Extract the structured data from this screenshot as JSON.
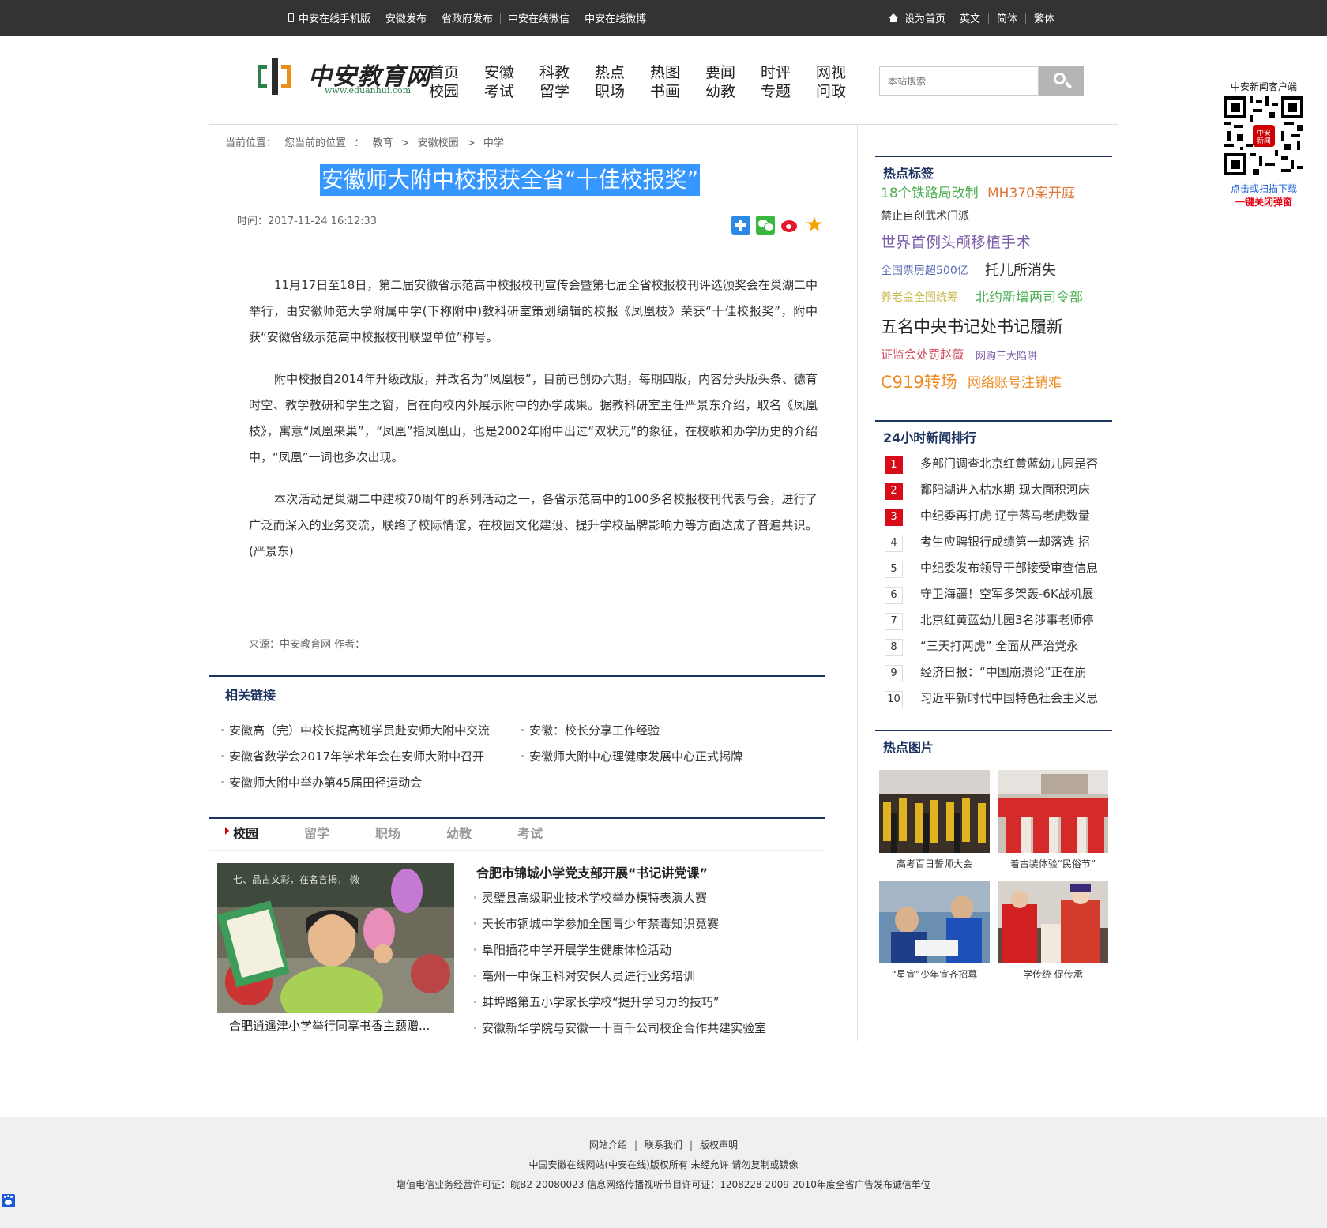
{
  "topbar": {
    "left_links": [
      "中安在线手机版",
      "安徽发布",
      "省政府发布",
      "中安在线微信",
      "中安在线微博"
    ],
    "right_links": [
      "设为首页",
      "英文",
      "简体",
      "繁体"
    ]
  },
  "logo": {
    "name": "中安教育网",
    "url": "www.eduanhui.com"
  },
  "nav": [
    [
      "首页",
      "校园"
    ],
    [
      "安徽",
      "考试"
    ],
    [
      "科教",
      "留学"
    ],
    [
      "热点",
      "职场"
    ],
    [
      "热图",
      "书画"
    ],
    [
      "要闻",
      "幼教"
    ],
    [
      "时评",
      "专题"
    ],
    [
      "网视",
      "问政"
    ]
  ],
  "search": {
    "placeholder": "本站搜索"
  },
  "qr": {
    "title": "中安新闻客户端",
    "line1": "点击或扫描下载",
    "line2": "一键关闭弹窗"
  },
  "breadcrumb": {
    "label": "当前位置：",
    "items": [
      "您当前的位置",
      "：",
      "教育",
      "&gt;",
      "安徽校园",
      "&gt;",
      "中学"
    ]
  },
  "article": {
    "title": "安徽师大附中校报获全省“十佳校报奖”",
    "time": "时间：2017-11-24 16:12:33",
    "paragraphs": [
      "11月17日至18日，第二届安徽省示范高中校报校刊宣传会暨第七届全省校报校刊评选颁奖会在巢湖二中举行，由安徽师范大学附属中学(下称附中)教科研室策划编辑的校报《凤凰枝》荣获“十佳校报奖”，附中获“安徽省级示范高中校报校刊联盟单位”称号。",
      "附中校报自2014年升级改版，并改名为“凤凰枝”，目前已创办六期，每期四版，内容分头版头条、德育时空、教学教研和学生之窗，旨在向校内外展示附中的办学成果。据教科研室主任严景东介绍，取名《凤凰枝》，寓意“凤凰来巢”，“凤凰”指凤凰山，也是2002年附中出过“双状元”的象征，在校歌和办学历史的介绍中，“凤凰”一词也多次出现。",
      "本次活动是巢湖二中建校70周年的系列活动之一，各省示范高中的100多名校报校刊代表与会，进行了广泛而深入的业务交流，联络了校际情谊，在校园文化建设、提升学校品牌影响力等方面达成了普遍共识。(严景东)"
    ],
    "source": "来源：中安教育网  作者："
  },
  "related": {
    "title": "相关链接",
    "links": [
      "安徽高（完）中校长提高班学员赴安师大附中交流",
      "安徽：校长分享工作经验",
      "安徽省数学会2017年学术年会在安师大附中召开",
      "安徽师大附中心理健康发展中心正式揭牌",
      "安徽师大附中举办第45届田径运动会"
    ]
  },
  "campus": {
    "tabs": [
      "校园",
      "留学",
      "职场",
      "幼教",
      "考试"
    ],
    "image_caption": "合肥逍遥津小学举行同享书香主题赠...",
    "headline": "合肥市锦城小学党支部开展“书记讲党课”",
    "list": [
      "灵璧县高级职业技术学校举办模特表演大赛",
      "天长市铜城中学参加全国青少年禁毒知识竞赛",
      "阜阳插花中学开展学生健康体检活动",
      "亳州一中保卫科对安保人员进行业务培训",
      "蚌埠路第五小学家长学校“提升学习力的技巧”",
      "安徽新华学院与安徽一十百千公司校企合作共建实验室"
    ]
  },
  "hot_tags": {
    "title": "热点标签",
    "tags": [
      {
        "text": "18个铁路局改制",
        "color": "#4caf50",
        "size": 17
      },
      {
        "text": "MH370案开庭",
        "color": "#e0763a",
        "size": 17
      },
      {
        "text": "禁止自创武术门派",
        "color": "#333333",
        "size": 14
      },
      {
        "text": "世界首例头颅移植手术",
        "color": "#7c5ca8",
        "size": 19
      },
      {
        "text": "全国票房超500亿",
        "color": "#5b6bb5",
        "size": 14
      },
      {
        "text": "托儿所消失",
        "color": "#333333",
        "size": 18
      },
      {
        "text": "养老金全国统筹",
        "color": "#c8b84a",
        "size": 14
      },
      {
        "text": "北约新增两司令部",
        "color": "#4caf50",
        "size": 17
      },
      {
        "text": "五名中央书记处书记履新",
        "color": "#222222",
        "size": 21
      },
      {
        "text": "证监会处罚赵薇",
        "color": "#d0495a",
        "size": 15
      },
      {
        "text": "网购三大陷阱",
        "color": "#7c5ca8",
        "size": 13
      },
      {
        "text": "C919转场",
        "color": "#f08a22",
        "size": 21
      },
      {
        "text": "网络账号注销难",
        "color": "#f08a22",
        "size": 17
      }
    ]
  },
  "ranking": {
    "title": "24小时新闻排行",
    "items": [
      "多部门调查北京红黄蓝幼儿园是否",
      "鄱阳湖进入枯水期 现大面积河床",
      "中纪委再打虎 辽宁落马老虎数量",
      "考生应聘银行成绩第一却落选 招",
      "中纪委发布领导干部接受审查信息",
      "守卫海疆！空军多架轰-6K战机展",
      "北京红黄蓝幼儿园3名涉事老师停",
      "“三天打两虎” 全面从严治党永",
      "经济日报：“中国崩溃论”正在崩",
      "习近平新时代中国特色社会主义思"
    ],
    "numbers": [
      "1",
      "2",
      "3",
      "4",
      "5",
      "6",
      "7",
      "8",
      "9",
      "10"
    ]
  },
  "hot_pics": {
    "title": "热点图片",
    "captions": [
      "高考百日誓师大会",
      "着古装体验“民俗节”",
      "“星宣”少年宣齐招募",
      "学传统 促传承"
    ]
  },
  "footer": {
    "links": [
      "网站介绍",
      "联系我们",
      "版权声明"
    ],
    "line2": "中国安徽在线网站(中安在线)版权所有 未经允许 请勿复制或镜像",
    "line3": "增值电信业务经营许可证：皖B2-20080023 信息网络传播视听节目许可证：1208228   2009-2010年度全省广告发布诚信单位"
  }
}
